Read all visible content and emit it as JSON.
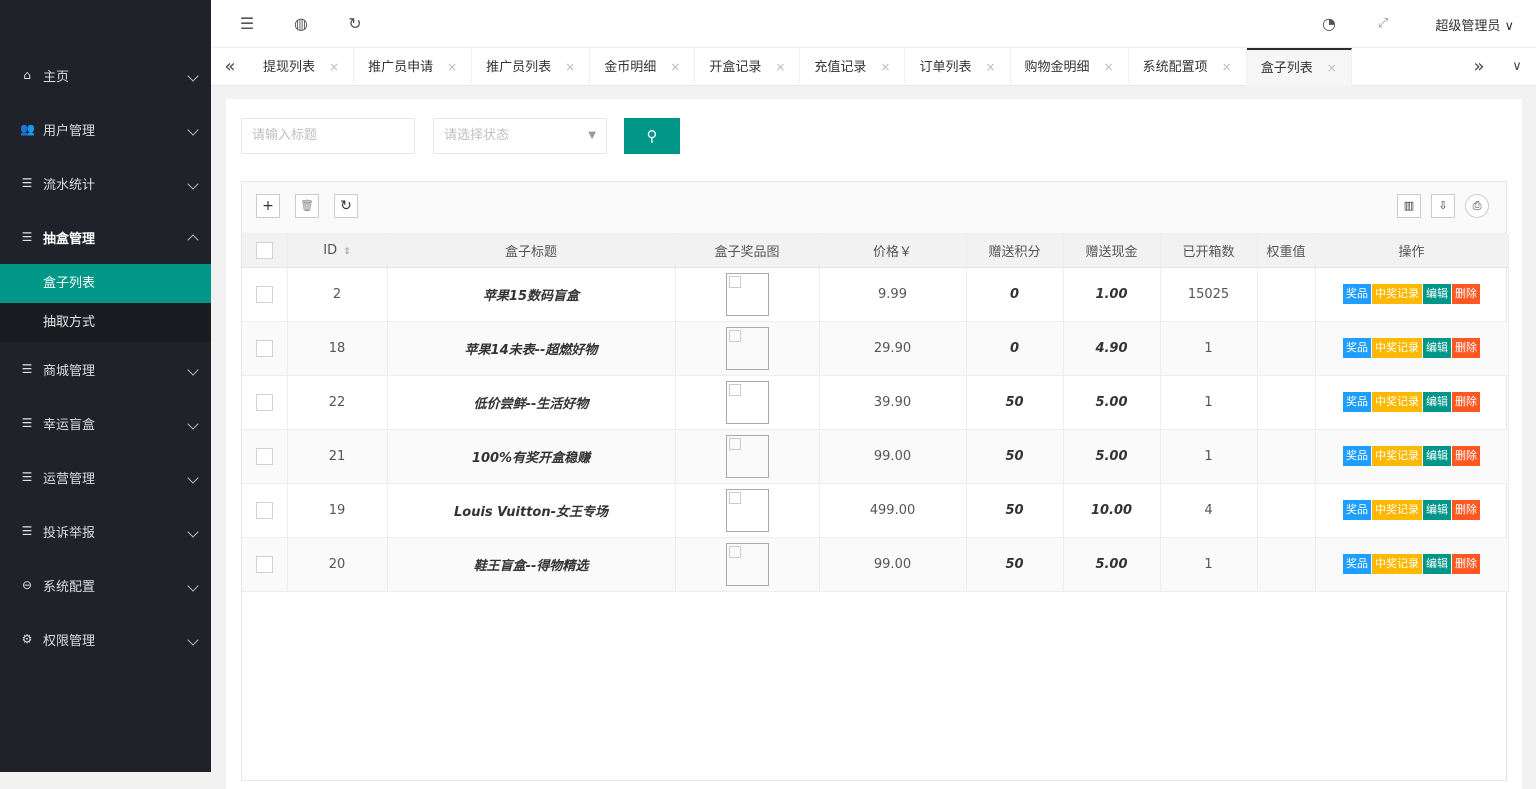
{
  "sidebar": {
    "items": [
      {
        "label": "主页",
        "icon": "home-icon"
      },
      {
        "label": "用户管理",
        "icon": "users-icon"
      },
      {
        "label": "流水统计",
        "icon": "list-icon"
      },
      {
        "label": "抽盒管理",
        "icon": "list-icon"
      },
      {
        "label": "商城管理",
        "icon": "list-icon"
      },
      {
        "label": "幸运盲盒",
        "icon": "list-icon"
      },
      {
        "label": "运营管理",
        "icon": "list-icon"
      },
      {
        "label": "投诉举报",
        "icon": "list-icon"
      },
      {
        "label": "系统配置",
        "icon": "settings-icon"
      },
      {
        "label": "权限管理",
        "icon": "gear-icon"
      }
    ],
    "sub_items": [
      "盒子列表",
      "抽取方式"
    ]
  },
  "header": {
    "user": "超级管理员"
  },
  "tabs": [
    "提现列表",
    "推广员申请",
    "推广员列表",
    "金币明细",
    "开盒记录",
    "充值记录",
    "订单列表",
    "购物金明细",
    "系统配置项",
    "盒子列表"
  ],
  "search": {
    "title_placeholder": "请输入标题",
    "status_placeholder": "请选择状态"
  },
  "table": {
    "headers": [
      "ID",
      "盒子标题",
      "盒子奖品图",
      "价格￥",
      "赠送积分",
      "赠送现金",
      "已开箱数",
      "权重值",
      "操作"
    ],
    "rows": [
      {
        "id": "2",
        "title": "苹果15数码盲盒",
        "price": "9.99",
        "points": "0",
        "cash": "1.00",
        "opened": "15025"
      },
      {
        "id": "18",
        "title": "苹果14未表--超燃好物",
        "price": "29.90",
        "points": "0",
        "cash": "4.90",
        "opened": "1"
      },
      {
        "id": "22",
        "title": "低价尝鲜--生活好物",
        "price": "39.90",
        "points": "50",
        "cash": "5.00",
        "opened": "1"
      },
      {
        "id": "21",
        "title": "100%有奖开盒稳赚",
        "price": "99.00",
        "points": "50",
        "cash": "5.00",
        "opened": "1"
      },
      {
        "id": "19",
        "title": "Louis Vuitton-女王专场",
        "price": "499.00",
        "points": "50",
        "cash": "10.00",
        "opened": "4"
      },
      {
        "id": "20",
        "title": "鞋王盲盒--得物精选",
        "price": "99.00",
        "points": "50",
        "cash": "5.00",
        "opened": "1"
      }
    ],
    "actions": [
      "奖品",
      "中奖记录",
      "编辑",
      "删除"
    ]
  },
  "colors": {
    "sidebar": "#20222a",
    "accent": "#009688",
    "blue": "#1e9fff",
    "orange": "#ffb800",
    "red": "#ff5722"
  }
}
